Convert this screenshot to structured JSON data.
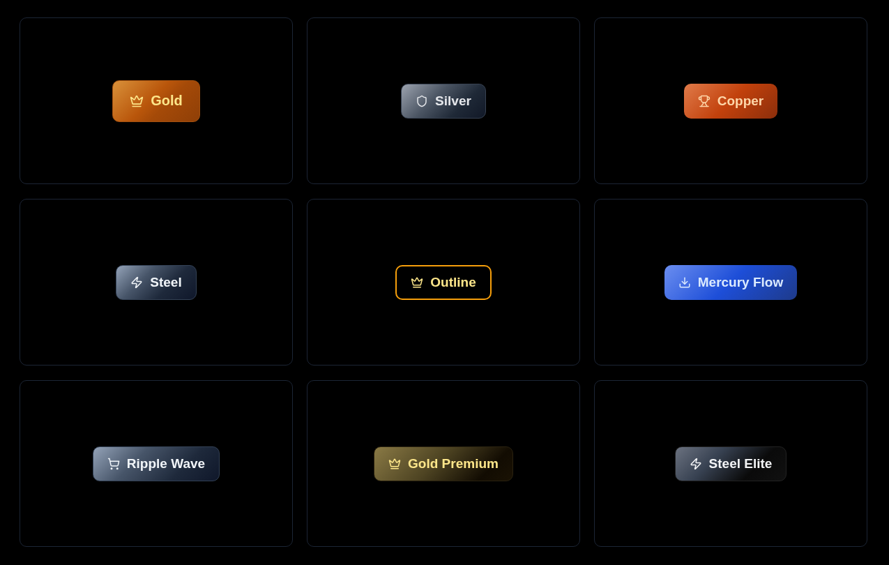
{
  "cards": [
    {
      "button": {
        "kind": "gold",
        "label": "Gold"
      }
    },
    {
      "button": {
        "kind": "silver",
        "label": "Silver"
      }
    },
    {
      "button": {
        "kind": "copper",
        "label": "Copper"
      }
    },
    {
      "button": {
        "kind": "steel",
        "label": "Steel"
      }
    },
    {
      "button": {
        "kind": "outline",
        "label": "Outline"
      }
    },
    {
      "button": {
        "kind": "mercury",
        "label": "Mercury Flow"
      }
    },
    {
      "button": {
        "kind": "ripple",
        "label": "Ripple Wave"
      }
    },
    {
      "button": {
        "kind": "goldpremium",
        "label": "Gold Premium"
      }
    },
    {
      "button": {
        "kind": "steelelite",
        "label": "Steel Elite"
      }
    }
  ]
}
